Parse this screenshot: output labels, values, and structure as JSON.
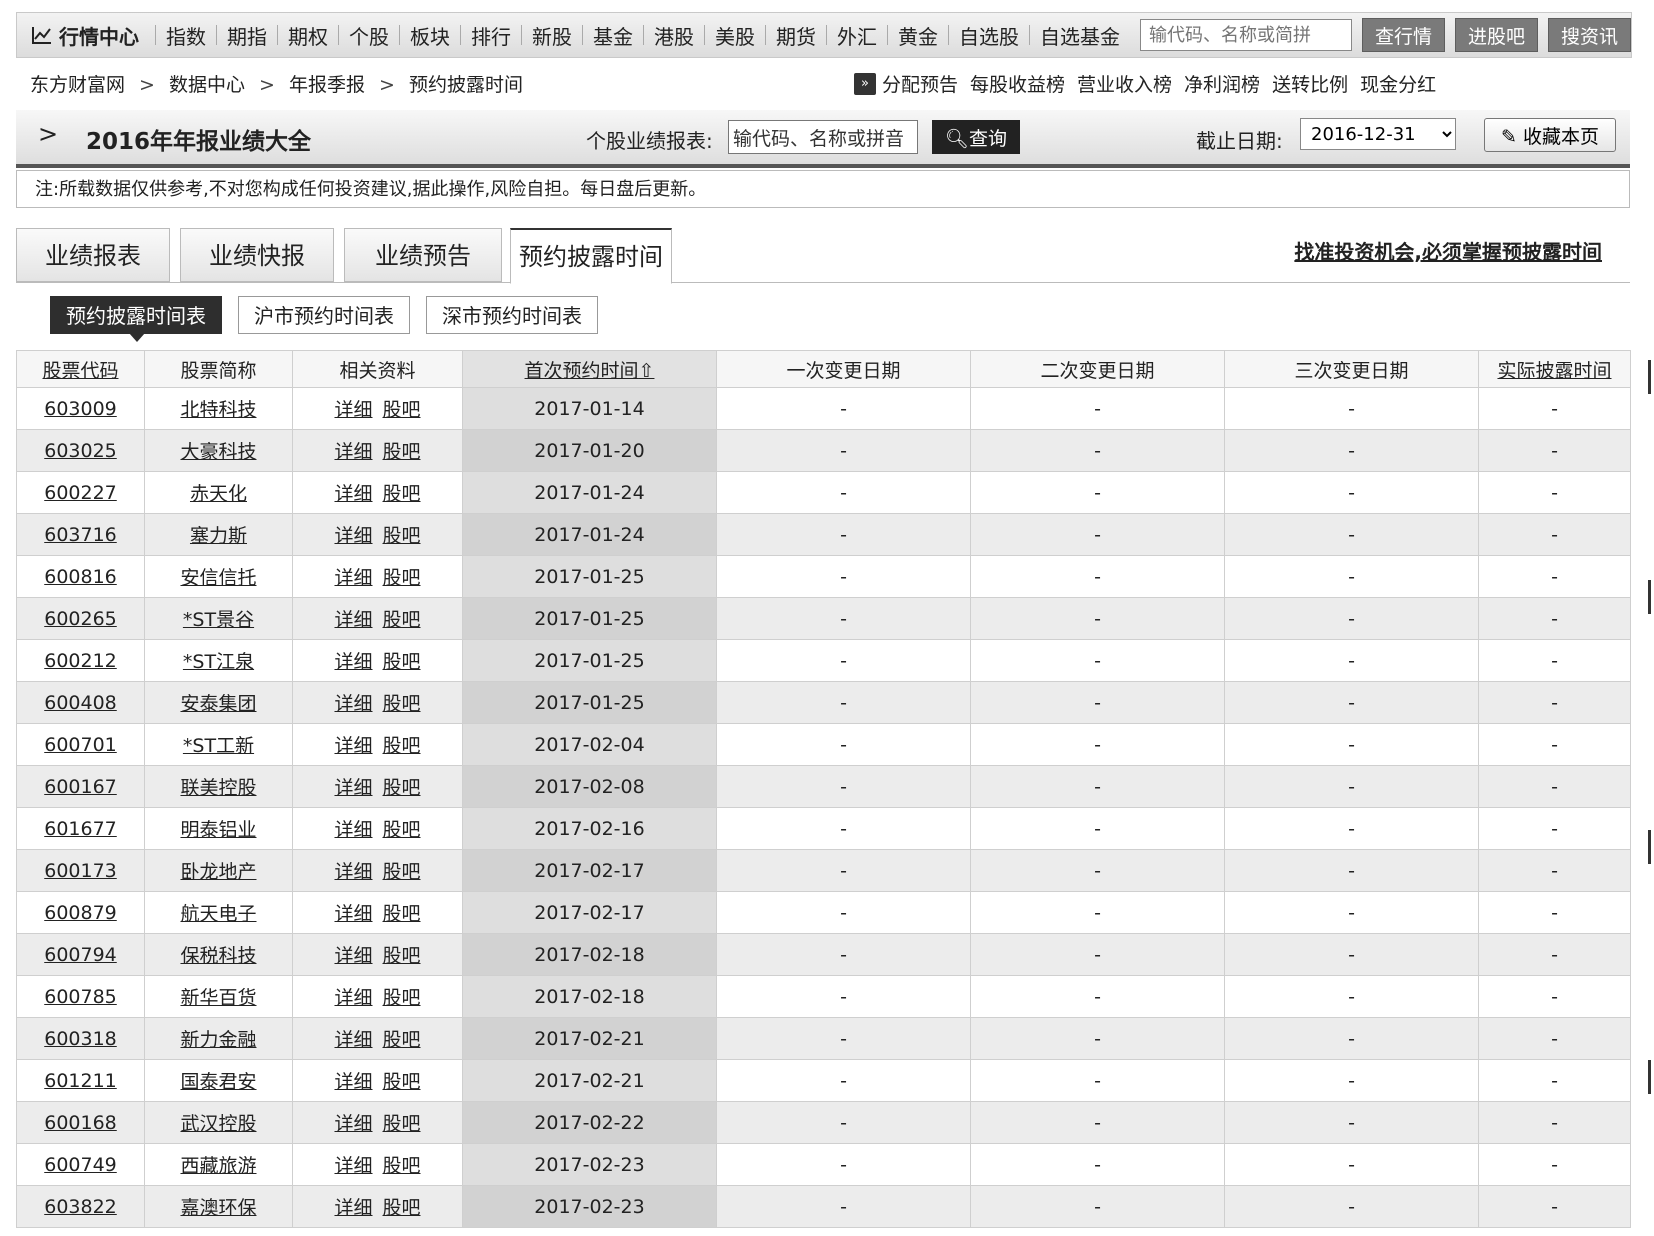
{
  "topbar": {
    "brand": "行情中心",
    "nav": [
      "指数",
      "期指",
      "期权",
      "个股",
      "板块",
      "排行",
      "新股",
      "基金",
      "港股",
      "美股",
      "期货",
      "外汇",
      "黄金",
      "自选股",
      "自选基金"
    ],
    "search_placeholder": "输代码、名称或简拼",
    "btn_quote": "查行情",
    "btn_bar": "进股吧",
    "btn_news": "搜资讯"
  },
  "breadcrumb": [
    "东方财富网",
    "数据中心",
    "年报季报",
    "预约披露时间"
  ],
  "quicklinks": [
    "分配预告",
    "每股收益榜",
    "营业收入榜",
    "净利润榜",
    "送转比例",
    "现金分红"
  ],
  "titlebar": {
    "title": "2016年年报业绩大全",
    "stock_label": "个股业绩报表:",
    "stock_input": "输代码、名称或拼音",
    "query_btn": "查询",
    "date_label": "截止日期:",
    "date_value": "2016-12-31",
    "fav_btn": "收藏本页"
  },
  "note": "注:所载数据仅供参考,不对您构成任何投资建议,据此操作,风险自担。每日盘后更新。",
  "tabs": [
    "业绩报表",
    "业绩快报",
    "业绩预告",
    "预约披露时间"
  ],
  "tabs_hint": "找准投资机会,必须掌握预披露时间",
  "subtabs": [
    "预约披露时间表",
    "沪市预约时间表",
    "深市预约时间表"
  ],
  "table": {
    "headers": [
      "股票代码",
      "股票简称",
      "相关资料",
      "首次预约时间",
      "一次变更日期",
      "二次变更日期",
      "三次变更日期",
      "实际披露时间"
    ],
    "sort_mark": "⇧",
    "link_detail": "详细",
    "link_bar": "股吧",
    "rows": [
      {
        "code": "603009",
        "name": "北特科技",
        "first": "2017-01-14",
        "c1": "-",
        "c2": "-",
        "c3": "-",
        "actual": "-"
      },
      {
        "code": "603025",
        "name": "大豪科技",
        "first": "2017-01-20",
        "c1": "-",
        "c2": "-",
        "c3": "-",
        "actual": "-"
      },
      {
        "code": "600227",
        "name": "赤天化",
        "first": "2017-01-24",
        "c1": "-",
        "c2": "-",
        "c3": "-",
        "actual": "-"
      },
      {
        "code": "603716",
        "name": "塞力斯",
        "first": "2017-01-24",
        "c1": "-",
        "c2": "-",
        "c3": "-",
        "actual": "-"
      },
      {
        "code": "600816",
        "name": "安信信托",
        "first": "2017-01-25",
        "c1": "-",
        "c2": "-",
        "c3": "-",
        "actual": "-"
      },
      {
        "code": "600265",
        "name": "*ST景谷",
        "first": "2017-01-25",
        "c1": "-",
        "c2": "-",
        "c3": "-",
        "actual": "-"
      },
      {
        "code": "600212",
        "name": "*ST江泉",
        "first": "2017-01-25",
        "c1": "-",
        "c2": "-",
        "c3": "-",
        "actual": "-"
      },
      {
        "code": "600408",
        "name": "安泰集团",
        "first": "2017-01-25",
        "c1": "-",
        "c2": "-",
        "c3": "-",
        "actual": "-"
      },
      {
        "code": "600701",
        "name": "*ST工新",
        "first": "2017-02-04",
        "c1": "-",
        "c2": "-",
        "c3": "-",
        "actual": "-"
      },
      {
        "code": "600167",
        "name": "联美控股",
        "first": "2017-02-08",
        "c1": "-",
        "c2": "-",
        "c3": "-",
        "actual": "-"
      },
      {
        "code": "601677",
        "name": "明泰铝业",
        "first": "2017-02-16",
        "c1": "-",
        "c2": "-",
        "c3": "-",
        "actual": "-"
      },
      {
        "code": "600173",
        "name": "卧龙地产",
        "first": "2017-02-17",
        "c1": "-",
        "c2": "-",
        "c3": "-",
        "actual": "-"
      },
      {
        "code": "600879",
        "name": "航天电子",
        "first": "2017-02-17",
        "c1": "-",
        "c2": "-",
        "c3": "-",
        "actual": "-"
      },
      {
        "code": "600794",
        "name": "保税科技",
        "first": "2017-02-18",
        "c1": "-",
        "c2": "-",
        "c3": "-",
        "actual": "-"
      },
      {
        "code": "600785",
        "name": "新华百货",
        "first": "2017-02-18",
        "c1": "-",
        "c2": "-",
        "c3": "-",
        "actual": "-"
      },
      {
        "code": "600318",
        "name": "新力金融",
        "first": "2017-02-21",
        "c1": "-",
        "c2": "-",
        "c3": "-",
        "actual": "-"
      },
      {
        "code": "601211",
        "name": "国泰君安",
        "first": "2017-02-21",
        "c1": "-",
        "c2": "-",
        "c3": "-",
        "actual": "-"
      },
      {
        "code": "600168",
        "name": "武汉控股",
        "first": "2017-02-22",
        "c1": "-",
        "c2": "-",
        "c3": "-",
        "actual": "-"
      },
      {
        "code": "600749",
        "name": "西藏旅游",
        "first": "2017-02-23",
        "c1": "-",
        "c2": "-",
        "c3": "-",
        "actual": "-"
      },
      {
        "code": "603822",
        "name": "嘉澳环保",
        "first": "2017-02-23",
        "c1": "-",
        "c2": "-",
        "c3": "-",
        "actual": "-"
      }
    ]
  }
}
